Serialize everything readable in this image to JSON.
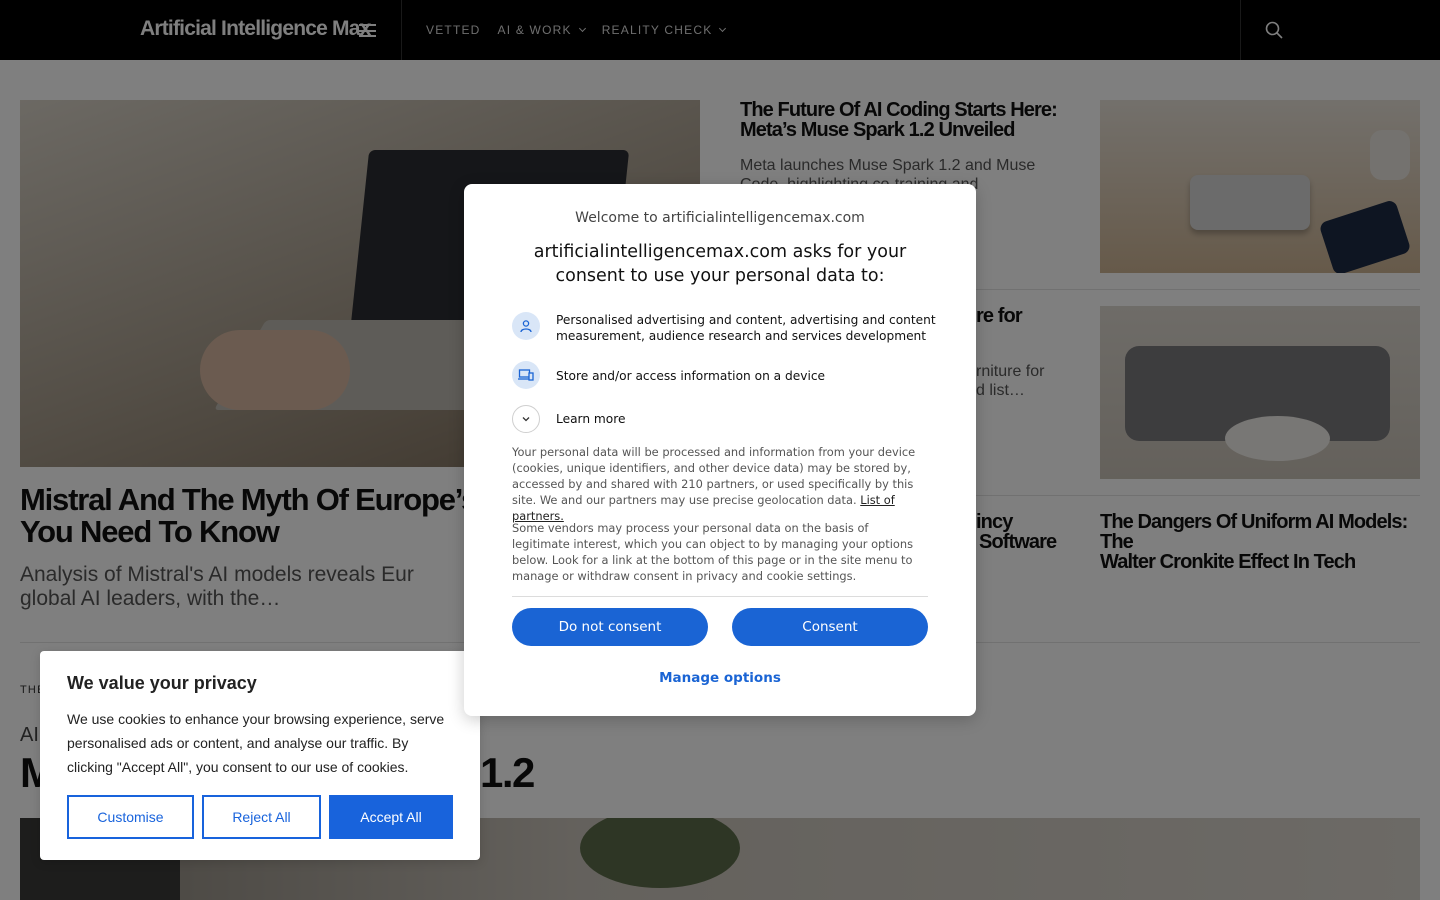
{
  "header": {
    "logo": "Artificial Intelligence Max",
    "nav": [
      {
        "label": "VETTED",
        "has_dropdown": false
      },
      {
        "label": "AI & WORK",
        "has_dropdown": true
      },
      {
        "label": "REALITY CHECK",
        "has_dropdown": true
      }
    ],
    "icons": [
      "menu-icon",
      "search-icon"
    ]
  },
  "hero": {
    "title": "Mistral And The Myth Of Europe’s A… You Need To Know",
    "title_line1": "Mistral And The Myth Of Europe’s A",
    "title_line2": "You Need To Know",
    "description_line1": "Analysis of Mistral's AI models reveals Eur",
    "description_line2": "global AI leaders, with the…"
  },
  "side_articles": [
    {
      "title_line1": "The Future Of AI Coding Starts Here:",
      "title_line2": "Meta’s Muse Spark 1.2 Unveiled",
      "desc_line1": "Meta launches Muse Spark 1.2 and Muse",
      "desc_line2": "Code, highlighting co-training and"
    },
    {
      "title_fragment": "re for",
      "desc_line1": "rniture for",
      "desc_line2": "d list…"
    },
    {
      "title_line1": "incy",
      "title_line2": "Software"
    },
    {
      "title_line1": "The Dangers Of Uniform AI Models: The",
      "title_line2": "Walter Cronkite Effect In Tech"
    }
  ],
  "featured": {
    "section_label": "THE",
    "category": "AI",
    "title_start": "M",
    "title_end": "1.2"
  },
  "consent_dialog": {
    "welcome": "Welcome to artificialintelligencemax.com",
    "heading": "artificialintelligencemax.com asks for your consent to use your personal data to:",
    "purposes": [
      {
        "icon": "person-icon",
        "text": "Personalised advertising and content, advertising and content measurement, audience research and services development"
      },
      {
        "icon": "devices-icon",
        "text": "Store and/or access information on a device"
      }
    ],
    "learn_more": "Learn more",
    "paragraph1": "Your personal data will be processed and information from your device (cookies, unique identifiers, and other device data) may be stored by, accessed by and shared with 210 partners, or used specifically by this site. We and our partners may use precise geolocation data.",
    "partners_link": "List of partners.",
    "paragraph2": "Some vendors may process your personal data on the basis of legitimate interest, which you can object to by managing your options below. Look for a link at the bottom of this page or in the site menu to manage or withdraw consent in privacy and cookie settings.",
    "do_not_consent": "Do not consent",
    "consent": "Consent",
    "manage_options": "Manage options"
  },
  "cookie_banner": {
    "title": "We value your privacy",
    "text": "We use cookies to enhance your browsing experience, serve personalised ads or content, and analyse our traffic. By clicking \"Accept All\", you consent to our use of cookies.",
    "customise": "Customise",
    "reject_all": "Reject All",
    "accept_all": "Accept All"
  },
  "colors": {
    "header_bg": "#000000",
    "consent_button": "#1a64d4",
    "cookie_accent": "#1863dc"
  }
}
